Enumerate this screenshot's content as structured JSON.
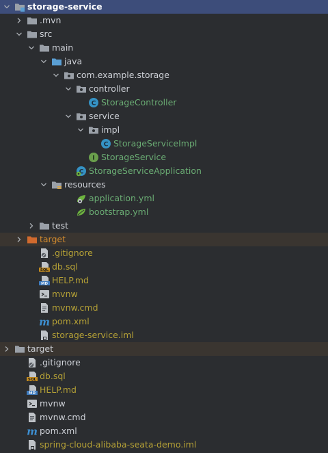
{
  "colors": {
    "background": "#2b2d30",
    "selected_row": "#3d4d7a",
    "excluded_row": "#3a3530",
    "folder": "#9aa0a8",
    "source_folder": "#5a9fd4",
    "excluded_folder": "#d16a2e",
    "class_icon": "#3592c4",
    "interface_icon": "#6a9f4c",
    "spring_green": "#6db33f",
    "text_default": "#cdd0d6",
    "text_green": "#6aab73",
    "text_olive": "#b5a136"
  },
  "tree": [
    {
      "label": "storage-service",
      "depth": 0,
      "arrow": "down",
      "icon": "module-folder-icon",
      "color": "bold",
      "selected": true
    },
    {
      "label": ".mvn",
      "depth": 1,
      "arrow": "right",
      "icon": "folder-icon",
      "color": "default"
    },
    {
      "label": "src",
      "depth": 1,
      "arrow": "down",
      "icon": "folder-icon",
      "color": "default"
    },
    {
      "label": "main",
      "depth": 2,
      "arrow": "down",
      "icon": "folder-icon",
      "color": "default"
    },
    {
      "label": "java",
      "depth": 3,
      "arrow": "down",
      "icon": "source-folder-icon",
      "color": "default"
    },
    {
      "label": "com.example.storage",
      "depth": 4,
      "arrow": "down",
      "icon": "package-icon",
      "color": "default"
    },
    {
      "label": "controller",
      "depth": 5,
      "arrow": "down",
      "icon": "package-icon",
      "color": "default"
    },
    {
      "label": "StorageController",
      "depth": 6,
      "arrow": "none",
      "icon": "class-icon",
      "color": "green"
    },
    {
      "label": "service",
      "depth": 5,
      "arrow": "down",
      "icon": "package-icon",
      "color": "default"
    },
    {
      "label": "impl",
      "depth": 6,
      "arrow": "down",
      "icon": "package-icon",
      "color": "default"
    },
    {
      "label": "StorageServiceImpl",
      "depth": 7,
      "arrow": "none",
      "icon": "class-icon",
      "color": "green"
    },
    {
      "label": "StorageService",
      "depth": 6,
      "arrow": "none",
      "icon": "interface-icon",
      "color": "green"
    },
    {
      "label": "StorageServiceApplication",
      "depth": 5,
      "arrow": "none",
      "icon": "spring-boot-class-icon",
      "color": "green"
    },
    {
      "label": "resources",
      "depth": 3,
      "arrow": "down",
      "icon": "resources-folder-icon",
      "color": "default"
    },
    {
      "label": "application.yml",
      "depth": 5,
      "arrow": "none",
      "icon": "spring-yml-icon",
      "color": "green"
    },
    {
      "label": "bootstrap.yml",
      "depth": 5,
      "arrow": "none",
      "icon": "spring-leaf-icon",
      "color": "green"
    },
    {
      "label": "test",
      "depth": 2,
      "arrow": "right",
      "icon": "folder-icon",
      "color": "default"
    },
    {
      "label": "target",
      "depth": 1,
      "arrow": "right",
      "icon": "excluded-folder-icon",
      "color": "orange",
      "highlight": true
    },
    {
      "label": ".gitignore",
      "depth": 2,
      "arrow": "none",
      "icon": "gitignore-icon",
      "color": "olive"
    },
    {
      "label": "db.sql",
      "depth": 2,
      "arrow": "none",
      "icon": "sql-file-icon",
      "color": "olive"
    },
    {
      "label": "HELP.md",
      "depth": 2,
      "arrow": "none",
      "icon": "markdown-file-icon",
      "color": "olive"
    },
    {
      "label": "mvnw",
      "depth": 2,
      "arrow": "none",
      "icon": "script-file-icon",
      "color": "olive"
    },
    {
      "label": "mvnw.cmd",
      "depth": 2,
      "arrow": "none",
      "icon": "text-file-icon",
      "color": "olive"
    },
    {
      "label": "pom.xml",
      "depth": 2,
      "arrow": "none",
      "icon": "maven-icon",
      "color": "olive"
    },
    {
      "label": "storage-service.iml",
      "depth": 2,
      "arrow": "none",
      "icon": "iml-file-icon",
      "color": "olive"
    },
    {
      "label": "target",
      "depth": 0,
      "arrow": "right",
      "icon": "folder-icon",
      "color": "default",
      "highlight": true
    },
    {
      "label": ".gitignore",
      "depth": 1,
      "arrow": "none",
      "icon": "gitignore-icon",
      "color": "default"
    },
    {
      "label": "db.sql",
      "depth": 1,
      "arrow": "none",
      "icon": "sql-file-icon",
      "color": "olive"
    },
    {
      "label": "HELP.md",
      "depth": 1,
      "arrow": "none",
      "icon": "markdown-file-icon",
      "color": "olive"
    },
    {
      "label": "mvnw",
      "depth": 1,
      "arrow": "none",
      "icon": "script-file-icon",
      "color": "default"
    },
    {
      "label": "mvnw.cmd",
      "depth": 1,
      "arrow": "none",
      "icon": "text-file-icon",
      "color": "default"
    },
    {
      "label": "pom.xml",
      "depth": 1,
      "arrow": "none",
      "icon": "maven-icon",
      "color": "default"
    },
    {
      "label": "spring-cloud-alibaba-seata-demo.iml",
      "depth": 1,
      "arrow": "none",
      "icon": "iml-file-icon",
      "color": "olive"
    }
  ]
}
